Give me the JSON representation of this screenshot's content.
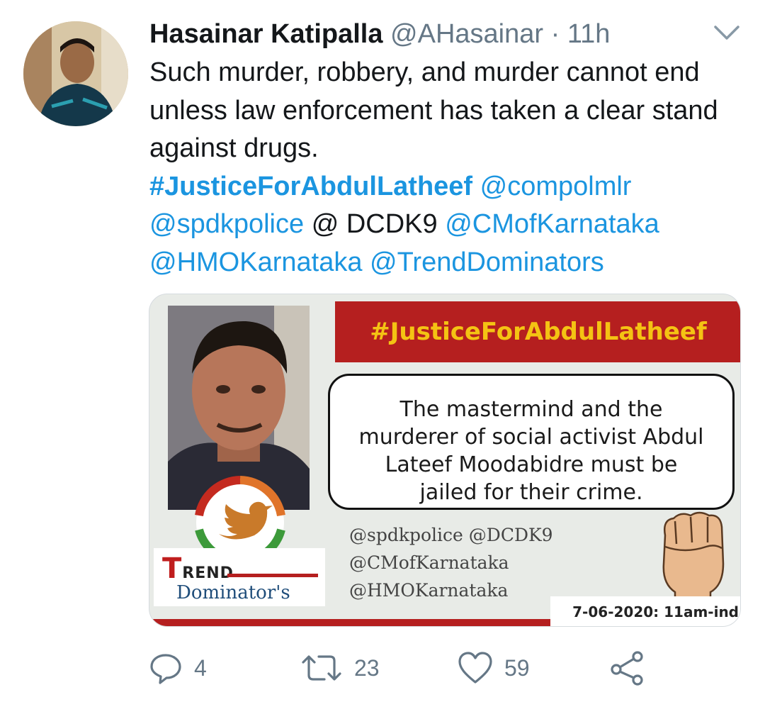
{
  "tweet": {
    "author_name": "Hasainar Katipalla",
    "handle": "@AHasainar",
    "separator": "·",
    "time": "11h",
    "text_part1": "Such murder, robbery, and murder cannot end unless law enforcement has taken a clear stand against drugs.",
    "hashtag": "#JusticeForAbdulLatheef",
    "mention_1": "@compolmlr",
    "mention_2": "@spdkpolice",
    "plain_at": "@ DCDK9",
    "mention_3": "@CMofKarnataka",
    "mention_4": "@HMOKarnataka",
    "mention_5": "@TrendDominators"
  },
  "card_image": {
    "banner": "#JusticeForAbdulLatheef",
    "speech_line1": "The mastermind and the",
    "speech_line2": "murderer of social activist Abdul",
    "speech_line3": "Lateef Moodabidre must be",
    "speech_line4": "jailed for their crime.",
    "trend_word": "REND",
    "trend_letter": "T",
    "dominators": "Dominator's",
    "mentions_line1": "@spdkpolice @DCDK9",
    "mentions_line2": "@CMofKarnataka",
    "mentions_line3": "@HMOKarnataka",
    "date": "7-06-2020: 11am-ind"
  },
  "actions": {
    "reply_count": "4",
    "retweet_count": "23",
    "like_count": "59"
  },
  "icons": [
    "chevron-down-icon",
    "reply-icon",
    "retweet-icon",
    "like-icon",
    "share-icon",
    "twitter-bird-icon"
  ],
  "colors": {
    "link": "#1b95e0",
    "secondary": "#657786",
    "banner_red": "#b51f1f",
    "banner_text": "#f4c313"
  }
}
